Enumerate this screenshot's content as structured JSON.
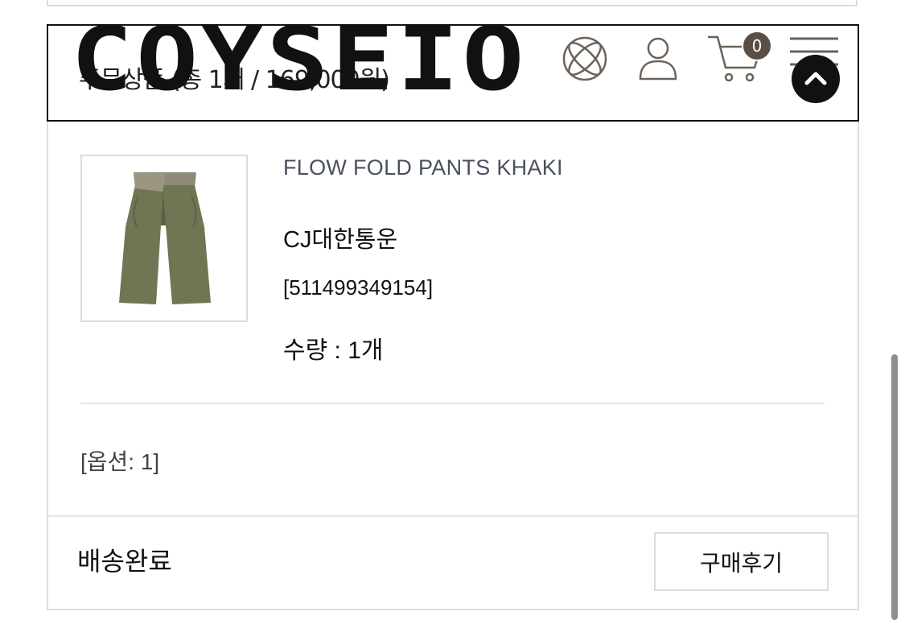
{
  "header": {
    "logo_text": "COYSEIO",
    "summary": "주문상품 (총 1개 / 169,000원)",
    "cart_count": "0",
    "icons": [
      "globe-icon",
      "user-icon",
      "cart-icon",
      "menu-icon",
      "chevron-up-icon"
    ]
  },
  "product": {
    "name": "FLOW FOLD PANTS KHAKI",
    "carrier": "CJ대한통운",
    "tracking": "[511499349154]",
    "quantity": "수량 : 1개"
  },
  "option": "[옵션: 1]",
  "footer": {
    "status": "배송완료",
    "review_button": "구매후기"
  },
  "colors": {
    "border": "#dcdcdc",
    "product_name": "#4a5060",
    "cart_badge": "#5a4f47",
    "pants": "#6f7654"
  }
}
